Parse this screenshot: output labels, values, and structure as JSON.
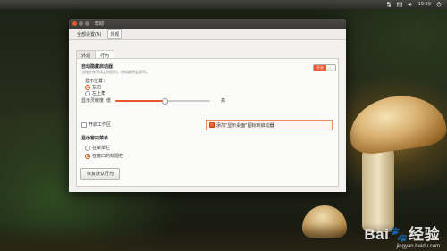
{
  "top_panel": {
    "time": "19:19"
  },
  "window": {
    "title": "帮助",
    "breadcrumbs": [
      "全部设置(A)",
      "外观"
    ],
    "tabs": [
      "外观",
      "行为"
    ],
    "auto_hide": {
      "title": "自动隐藏启动器",
      "description": "当指针移到设定热区时，启动器将会显示。",
      "switch_label": "开启"
    },
    "reveal_location": {
      "label": "显示位置：",
      "options": [
        "左边",
        "左上角"
      ],
      "selected": 0
    },
    "sensitivity": {
      "label": "显示灵敏度",
      "low": "低",
      "high": "高",
      "value": 0.52
    },
    "workspaces_label": "开启工作区",
    "show_desktop_label": "添加\"显示桌面\"图标到启动器",
    "menus": {
      "title": "显示窗口菜单",
      "options": [
        "在菜单栏",
        "在窗口的标题栏"
      ],
      "selected": 1
    },
    "restore_button": "恢复默认行为"
  },
  "watermark": {
    "brand": "Bai🐾经验",
    "url": "jingyan.baidu.com"
  },
  "colors": {
    "accent": "#e8582a",
    "panel": "#3c3b37"
  }
}
